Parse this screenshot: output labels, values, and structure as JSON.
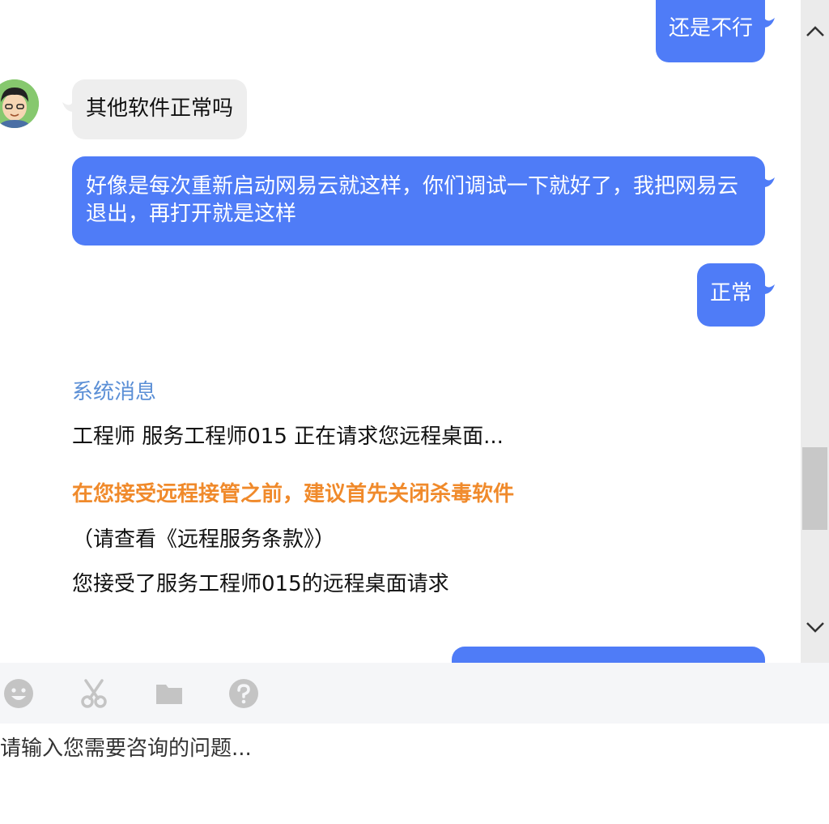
{
  "chat": {
    "messages": [
      {
        "from": "user",
        "text": "还是不行"
      },
      {
        "from": "agent",
        "text": "其他软件正常吗"
      },
      {
        "from": "user",
        "text": "好像是每次重新启动网易云就这样，你们调试一下就好了，我把网易云退出，再打开就是这样"
      },
      {
        "from": "user",
        "text": "正常"
      }
    ],
    "system": {
      "title": "系统消息",
      "line1": "工程师 服务工程师015 正在请求您远程桌面...",
      "warning": "在您接受远程接管之前，建议首先关闭杀毒软件",
      "terms": "（请查看《远程服务条款》）",
      "accepted": "您接受了服务工程师015的远程桌面请求"
    }
  },
  "toolbar": {
    "icons": [
      "emoji-icon",
      "scissors-icon",
      "folder-icon",
      "help-icon"
    ]
  },
  "input": {
    "placeholder": "请输入您需要咨询的问题..."
  },
  "colors": {
    "user_bubble": "#4f7cf7",
    "agent_bubble": "#eeeeee",
    "system_title": "#5b8fd6",
    "warning": "#f08a2b",
    "icon_gray": "#c4c4c4"
  }
}
